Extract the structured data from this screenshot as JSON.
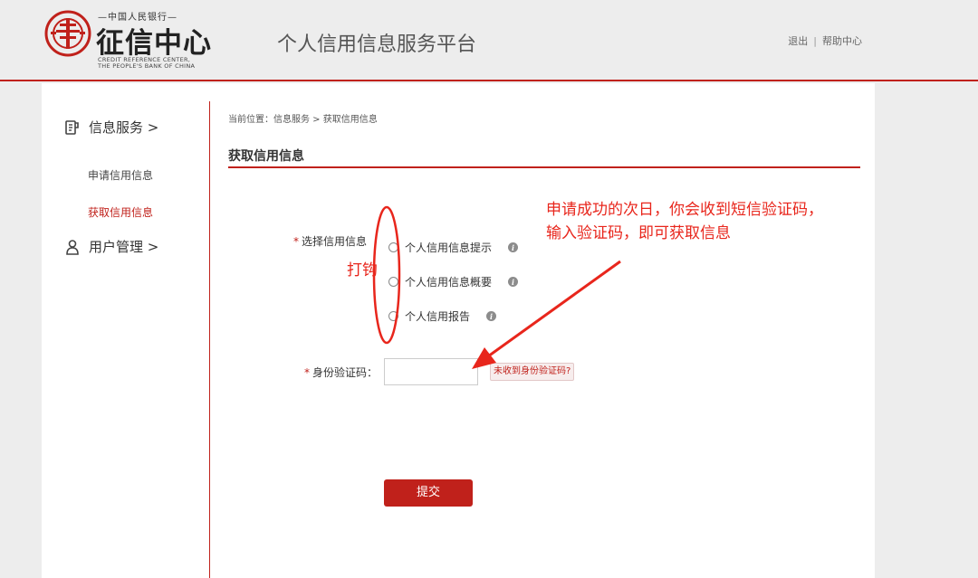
{
  "header": {
    "logo_top": "—中国人民银行—",
    "logo_main": "征信中心",
    "logo_en_line1": "CREDIT REFERENCE CENTER,",
    "logo_en_line2": "THE PEOPLE'S BANK OF CHINA",
    "platform_title": "个人信用信息服务平台",
    "logout": "退出",
    "separator": "|",
    "help": "帮助中心"
  },
  "sidebar": {
    "info_service": {
      "label": "信息服务 >",
      "icon": "document-icon"
    },
    "items": [
      {
        "label": "申请信用信息",
        "active": false
      },
      {
        "label": "获取信用信息",
        "active": true
      }
    ],
    "user_mgmt": {
      "label": "用户管理 >",
      "icon": "user-icon"
    }
  },
  "main": {
    "breadcrumb": "当前位置：信息服务 > 获取信用信息",
    "section_title": "获取信用信息",
    "select_label": "选择信用信息",
    "required_mark": "*",
    "options": [
      {
        "label": "个人信用信息提示"
      },
      {
        "label": "个人信用信息概要"
      },
      {
        "label": "个人信用报告"
      }
    ],
    "info_glyph": "i",
    "id_code_label": "身份验证码：",
    "not_received": "未收到身份验证码?",
    "submit": "提交"
  },
  "annotations": {
    "check_hint": "打钩",
    "sms_hint_line1": "申请成功的次日，你会收到短信验证码，",
    "sms_hint_line2": "输入验证码，即可获取信息",
    "color": "#e8261c"
  },
  "colors": {
    "brand_red": "#c0211b",
    "page_bg": "#ededed",
    "panel_bg": "#ffffff"
  }
}
